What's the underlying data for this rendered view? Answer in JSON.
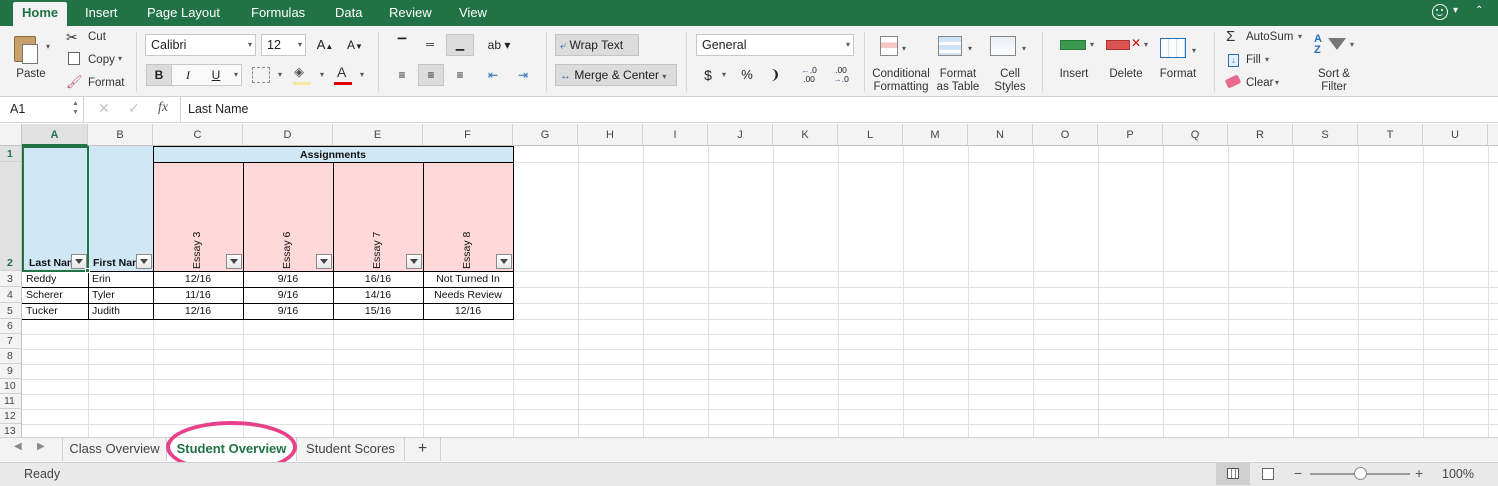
{
  "ribbon_tabs": [
    "Home",
    "Insert",
    "Page Layout",
    "Formulas",
    "Data",
    "Review",
    "View"
  ],
  "clipboard": {
    "paste": "Paste",
    "cut": "Cut",
    "copy": "Copy",
    "format": "Format"
  },
  "font": {
    "name": "Calibri",
    "size": "12",
    "bold": "B",
    "italic": "I",
    "underline": "U"
  },
  "alignment": {
    "wrap_text": "Wrap Text",
    "merge_center": "Merge & Center"
  },
  "number": {
    "format": "General",
    "currency": "$",
    "percent": "%",
    "comma": "❩",
    "inc_decimal": ".0",
    "dec_decimal": ".00"
  },
  "styles": {
    "conditional": "Conditional",
    "formatting": "Formatting",
    "format_as": "Format",
    "as_table": "as Table",
    "cell": "Cell",
    "cell_styles": "Styles"
  },
  "cells": {
    "insert": "Insert",
    "delete": "Delete",
    "format": "Format"
  },
  "editing": {
    "autosum": "AutoSum",
    "fill": "Fill",
    "clear": "Clear",
    "sort": "Sort &",
    "filter": "Filter"
  },
  "formula_bar": {
    "name_box": "A1",
    "fx": "fx",
    "value": "Last Name"
  },
  "columns": [
    "A",
    "B",
    "C",
    "D",
    "E",
    "F",
    "G",
    "H",
    "I",
    "J",
    "K",
    "L",
    "M",
    "N",
    "O",
    "P",
    "Q",
    "R",
    "S",
    "T",
    "U"
  ],
  "rows": [
    "1",
    "2",
    "3",
    "4",
    "5",
    "6",
    "7",
    "8",
    "9",
    "10",
    "11",
    "12",
    "13"
  ],
  "sheet": {
    "group_header": "Assignments",
    "header_last": "Last Name",
    "header_first": "First Name",
    "essays": [
      "Essay 3",
      "Essay 6",
      "Essay 7",
      "Essay 8"
    ],
    "data": [
      {
        "last": "Reddy",
        "first": "Erin",
        "scores": [
          "12/16",
          "9/16",
          "16/16",
          "Not Turned In"
        ]
      },
      {
        "last": "Scherer",
        "first": "Tyler",
        "scores": [
          "11/16",
          "9/16",
          "14/16",
          "Needs Review"
        ]
      },
      {
        "last": "Tucker",
        "first": "Judith",
        "scores": [
          "12/16",
          "9/16",
          "15/16",
          "12/16"
        ]
      }
    ]
  },
  "sheet_tabs": [
    "Class Overview",
    "Student Overview",
    "Student Scores"
  ],
  "add_sheet": "+",
  "status": {
    "ready": "Ready",
    "zoom": "100%",
    "minus": "−",
    "plus": "+"
  },
  "colors": {
    "excel_green": "#217346",
    "header_blue": "#d0e7f5",
    "header_pink": "#ffd9d9",
    "highlight_circle": "#e6418a"
  }
}
